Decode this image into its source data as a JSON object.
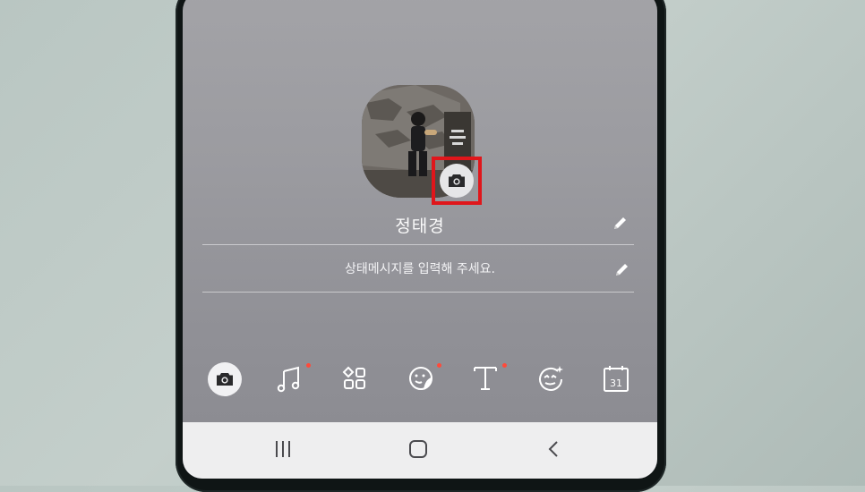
{
  "profile": {
    "name": "정태경",
    "status_placeholder": "상태메시지를 입력해 주세요."
  },
  "toolbar": {
    "items": [
      {
        "icon": "camera-icon",
        "active": true,
        "badge": false
      },
      {
        "icon": "music-icon",
        "active": false,
        "badge": true
      },
      {
        "icon": "grid-icon",
        "active": false,
        "badge": false
      },
      {
        "icon": "sticker-icon",
        "active": false,
        "badge": true
      },
      {
        "icon": "text-icon",
        "active": false,
        "badge": true
      },
      {
        "icon": "effect-icon",
        "active": false,
        "badge": false
      },
      {
        "icon": "calendar-icon",
        "active": false,
        "badge": false,
        "label": "31"
      }
    ]
  },
  "navigation": {
    "buttons": [
      "recent-apps-icon",
      "home-icon",
      "back-icon"
    ]
  },
  "colors": {
    "highlight": "#e0161b",
    "badge": "#ff4a3a",
    "text": "#fbfbfb"
  }
}
